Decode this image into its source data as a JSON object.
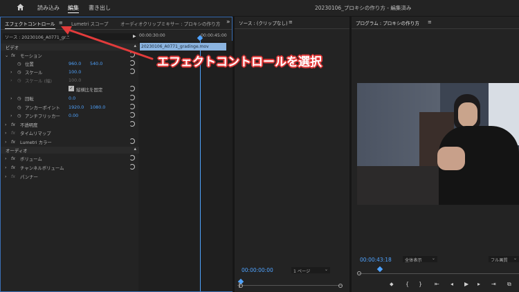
{
  "topbar": {
    "home_icon": "home-icon",
    "tabs": [
      {
        "label": "読み込み"
      },
      {
        "label": "編集"
      },
      {
        "label": "書き出し"
      }
    ],
    "title": "20230106_プロキシの作り方 - 編集済み"
  },
  "effect_panel": {
    "tabs": [
      {
        "label": "エフェクトコントロール"
      },
      {
        "label": "Lumetri スコープ"
      },
      {
        "label": "オーディオクリップミキサー : プロキシの作り方"
      }
    ],
    "source_label": "ソース : 20230106_A0771_gr...",
    "timecode_start": "00:00:30:00",
    "timecode_end": "00:00:45:00",
    "clip_name": "20230106_A0771_gradinge.mov",
    "video_section": "ビデオ",
    "audio_section": "オーディオ",
    "motion": "モーション",
    "position_label": "位置",
    "position_x": "960.0",
    "position_y": "540.0",
    "scale_label": "スケール",
    "scale_value": "100.0",
    "scale_width_label": "スケール (幅)",
    "scale_width_value": "100.0",
    "uniform_scale_label": "縦横比を固定",
    "rotation_label": "回転",
    "rotation_value": "0.0",
    "anchor_label": "アンカーポイント",
    "anchor_x": "1920.0",
    "anchor_y": "1080.0",
    "antiflicker_label": "アンチフリッカー",
    "antiflicker_value": "0.00",
    "opacity_label": "不透明度",
    "time_remap_label": "タイムリマップ",
    "lumetri_label": "Lumetri カラー",
    "volume_label": "ボリューム",
    "channel_volume_label": "チャンネルボリューム",
    "panner_label": "パンナー",
    "fx_label": "fx"
  },
  "source_panel": {
    "title": "ソース : (クリップなし)",
    "timecode": "00:00:00:00",
    "page_select": "1 ページ"
  },
  "program_panel": {
    "title": "プログラム : プロキシの作り方",
    "timecode": "00:00:43:18",
    "zoom_select": "全体表示",
    "quality_select": "フル画質"
  },
  "annotation": {
    "text": "エフェクトコントロールを選択"
  },
  "colors": {
    "accent_blue": "#4fa3ff",
    "annotation_red": "#e23b3b"
  }
}
